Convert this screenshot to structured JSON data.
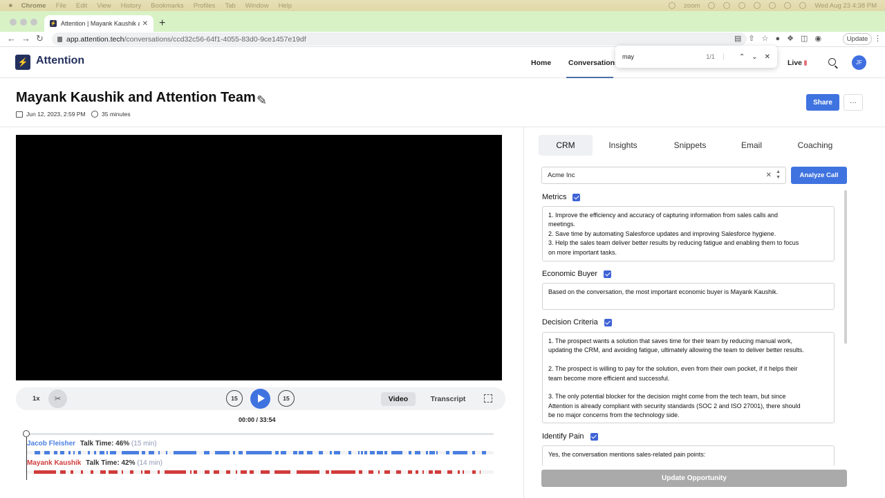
{
  "menubar": {
    "app": "Chrome",
    "items": [
      "File",
      "Edit",
      "View",
      "History",
      "Bookmarks",
      "Profiles",
      "Tab",
      "Window",
      "Help"
    ],
    "right_app": "zoom",
    "datetime": "Wed Aug 23  4:38 PM"
  },
  "browser": {
    "tab_title": "Attention | Mayank Kaushik and",
    "url_host": "app.attention.tech",
    "url_path": "/conversations/ccd32c56-64f1-4055-83d0-9ce1457e19df",
    "update_label": "Update",
    "find": {
      "query": "may",
      "count": "1/1"
    }
  },
  "header": {
    "logo": "Attention",
    "nav": [
      "Home",
      "Conversations",
      "Live"
    ],
    "avatar": "JF"
  },
  "page": {
    "title": "Mayank Kaushik and Attention Team",
    "date": "Jun 12, 2023, 2:59 PM",
    "duration": "35 minutes",
    "share": "Share",
    "more": "···"
  },
  "player": {
    "speed": "1x",
    "skip_back": "15",
    "skip_fwd": "15",
    "tab_video": "Video",
    "tab_transcript": "Transcript",
    "time": "00:00 / 33:54",
    "speakers": [
      {
        "name": "Jacob Fleisher",
        "talk": "Talk Time: 46%",
        "dur": "(15 min)",
        "color": "#4a7fe0"
      },
      {
        "name": "Mayank Kaushik",
        "talk": "Talk Time: 42%",
        "dur": "(14 min)",
        "color": "#d13b3b"
      }
    ]
  },
  "crm": {
    "tabs": [
      "CRM",
      "Insights",
      "Snippets",
      "Email",
      "Coaching"
    ],
    "account": "Acme Inc",
    "analyze": "Analyze Call",
    "fields": [
      {
        "label": "Metrics",
        "lines": [
          "1. Improve the efficiency and accuracy of capturing information from sales calls and",
          "meetings.",
          "2. Save time by automating Salesforce updates and improving Salesforce hygiene.",
          "3. Help the sales team deliver better results by reducing fatigue and enabling them to focus",
          "on more important tasks."
        ]
      },
      {
        "label": "Economic Buyer",
        "lines": [
          "Based on the conversation, the most important economic buyer is Mayank Kaushik."
        ]
      },
      {
        "label": "Decision Criteria",
        "lines": [
          "1. The prospect wants a solution that saves time for their team by reducing manual work,",
          "updating the CRM, and avoiding fatigue, ultimately allowing the team to deliver better results.",
          "",
          "2. The prospect is willing to pay for the solution, even from their own pocket, if it helps their",
          "team become more efficient and successful.",
          "",
          "3. The only potential blocker for the decision might come from the tech team, but since",
          "Attention is already compliant with security standards (SOC 2 and ISO 27001), there should",
          "be no major concerns from the technology side."
        ]
      },
      {
        "label": "Identify Pain",
        "lines": [
          "Yes, the conversation mentions sales-related pain points:"
        ]
      }
    ],
    "update_btn": "Update Opportunity"
  }
}
